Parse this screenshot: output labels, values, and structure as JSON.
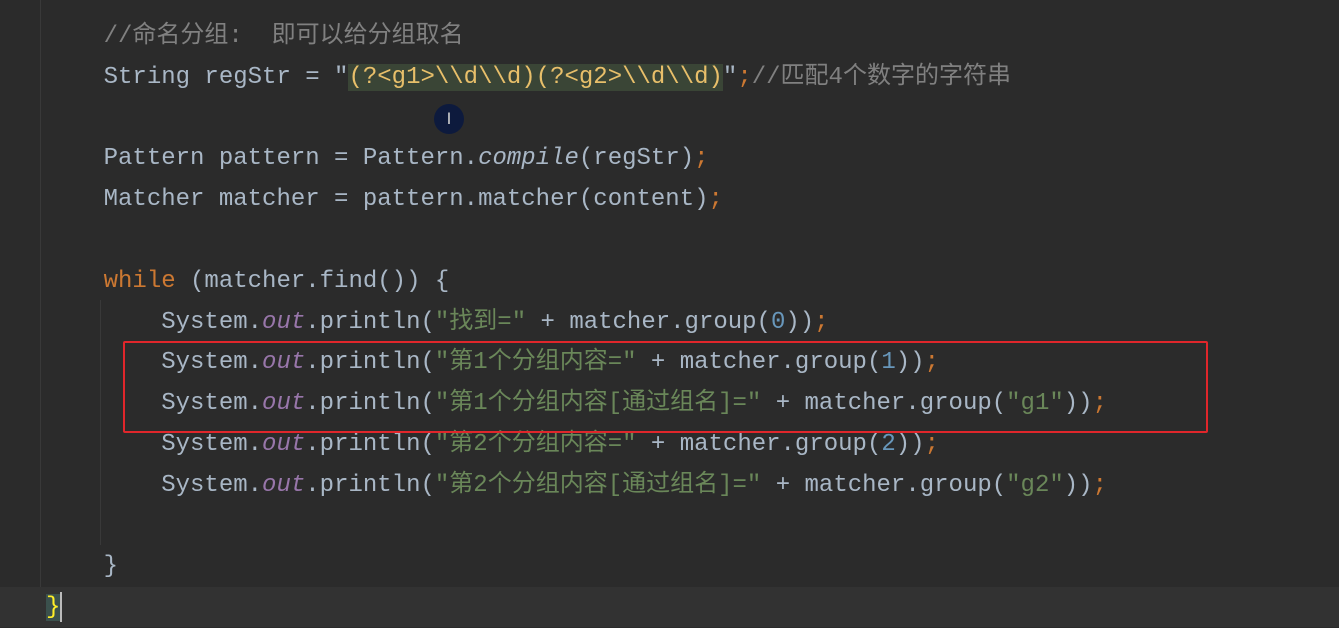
{
  "editor": {
    "colors": {
      "background": "#2b2b2b",
      "keyword": "#cc7832",
      "string": "#6a8759",
      "comment": "#808080",
      "number": "#6897bb",
      "field": "#9876aa",
      "highlight_box": "#e0262b"
    },
    "lines": [
      {
        "indent": "    ",
        "tokens": [
          {
            "t": "//命名分组:  即可以给分组取名",
            "c": "cm"
          }
        ]
      },
      {
        "indent": "    ",
        "tokens": [
          {
            "t": "String regStr = \""
          },
          {
            "t": "(?<g1>\\\\d\\\\d)(?<g2>\\\\d\\\\d)",
            "c": "rx"
          },
          {
            "t": "\""
          },
          {
            "t": ";",
            "c": "semi"
          },
          {
            "t": "//匹配4个数字的字符串",
            "c": "cm"
          }
        ]
      },
      {
        "indent": "",
        "tokens": []
      },
      {
        "indent": "    ",
        "tokens": [
          {
            "t": "Pattern pattern = Pattern."
          },
          {
            "t": "compile",
            "c": "it"
          },
          {
            "t": "(regStr)"
          },
          {
            "t": ";",
            "c": "semi"
          }
        ]
      },
      {
        "indent": "    ",
        "tokens": [
          {
            "t": "Matcher matcher = pattern.matcher(content)"
          },
          {
            "t": ";",
            "c": "semi"
          }
        ]
      },
      {
        "indent": "",
        "tokens": []
      },
      {
        "indent": "    ",
        "tokens": [
          {
            "t": "while",
            "c": "kw"
          },
          {
            "t": " (matcher.find()) {"
          }
        ]
      },
      {
        "indent": "        ",
        "tokens": [
          {
            "t": "System."
          },
          {
            "t": "out",
            "c": "fld"
          },
          {
            "t": ".println("
          },
          {
            "t": "\"找到=\"",
            "c": "str"
          },
          {
            "t": " + matcher.group("
          },
          {
            "t": "0",
            "c": "num"
          },
          {
            "t": "))"
          },
          {
            "t": ";",
            "c": "semi"
          }
        ]
      },
      {
        "indent": "        ",
        "tokens": [
          {
            "t": "System."
          },
          {
            "t": "out",
            "c": "fld"
          },
          {
            "t": ".println("
          },
          {
            "t": "\"第1个分组内容=\"",
            "c": "str"
          },
          {
            "t": " + matcher.group("
          },
          {
            "t": "1",
            "c": "num"
          },
          {
            "t": "))"
          },
          {
            "t": ";",
            "c": "semi"
          }
        ]
      },
      {
        "indent": "        ",
        "tokens": [
          {
            "t": "System."
          },
          {
            "t": "out",
            "c": "fld"
          },
          {
            "t": ".println("
          },
          {
            "t": "\"第1个分组内容[通过组名]=\"",
            "c": "str"
          },
          {
            "t": " + matcher.group("
          },
          {
            "t": "\"g1\"",
            "c": "str"
          },
          {
            "t": "))"
          },
          {
            "t": ";",
            "c": "semi"
          }
        ]
      },
      {
        "indent": "        ",
        "tokens": [
          {
            "t": "System."
          },
          {
            "t": "out",
            "c": "fld"
          },
          {
            "t": ".println("
          },
          {
            "t": "\"第2个分组内容=\"",
            "c": "str"
          },
          {
            "t": " + matcher.group("
          },
          {
            "t": "2",
            "c": "num"
          },
          {
            "t": "))"
          },
          {
            "t": ";",
            "c": "semi"
          }
        ]
      },
      {
        "indent": "        ",
        "tokens": [
          {
            "t": "System."
          },
          {
            "t": "out",
            "c": "fld"
          },
          {
            "t": ".println("
          },
          {
            "t": "\"第2个分组内容[通过组名]=\"",
            "c": "str"
          },
          {
            "t": " + matcher.group("
          },
          {
            "t": "\"g2\"",
            "c": "str"
          },
          {
            "t": "))"
          },
          {
            "t": ";",
            "c": "semi"
          }
        ]
      },
      {
        "indent": "",
        "tokens": []
      },
      {
        "indent": "    ",
        "tokens": [
          {
            "t": "}"
          }
        ]
      },
      {
        "indent": "",
        "tokens": [
          {
            "t": "}",
            "c": "brace"
          }
        ],
        "caret": true
      }
    ]
  },
  "mouse_cursor": "I"
}
